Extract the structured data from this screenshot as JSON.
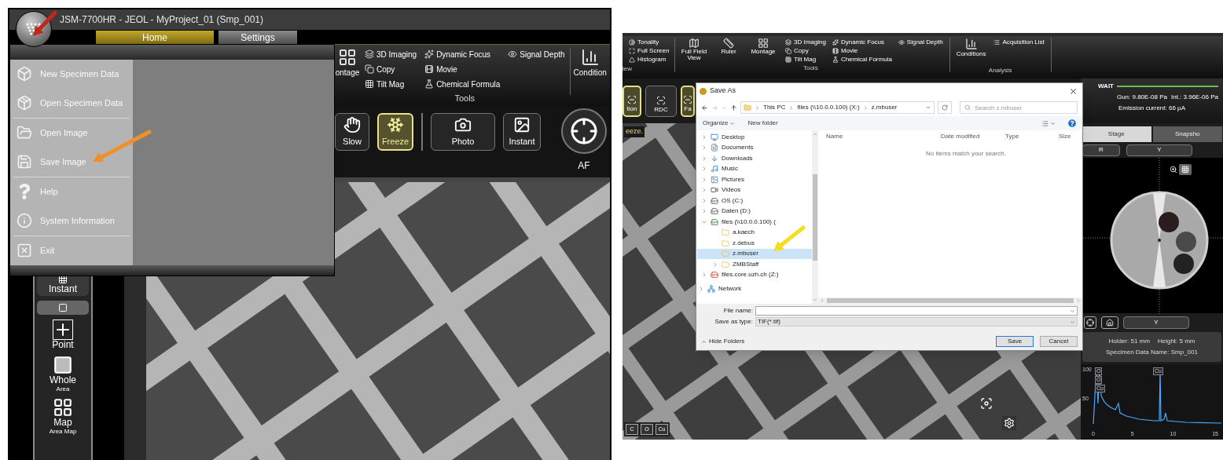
{
  "left_screen": {
    "window_title": "JSM-7700HR - JEOL - MyProject_01 (Smp_001)",
    "tabs": [
      {
        "label": "Home",
        "selected": true
      },
      {
        "label": "Settings",
        "selected": false
      }
    ],
    "ribbon": {
      "montage_label": "ontage",
      "tool_columns": [
        [
          "3D Imaging",
          "Copy",
          "Tilt Mag"
        ],
        [
          "Dynamic Focus",
          "Movie",
          "Chemical Formula"
        ],
        [
          "Signal Depth"
        ]
      ],
      "group_label": "Tools",
      "conditions_label": "Condition"
    },
    "buttons": [
      {
        "label": "Slow",
        "selected": false
      },
      {
        "label": "Freeze",
        "selected": true
      },
      {
        "label": "Photo",
        "selected": false
      },
      {
        "label": "Instant",
        "selected": false
      }
    ],
    "af_label": "AF",
    "sidebar": [
      {
        "label": "Instant"
      },
      {
        "label": "Point"
      },
      {
        "label": "Whole",
        "sublabel": "Area"
      },
      {
        "label": "Map",
        "sublabel": "Area Map"
      }
    ],
    "app_menu": {
      "groups": [
        [
          "New Specimen Data",
          "Open Specimen Data"
        ],
        [
          "Open Image",
          "Save Image"
        ],
        [
          "Help",
          "System Information"
        ],
        [
          "Exit"
        ]
      ]
    }
  },
  "right_screen": {
    "ribbon": {
      "view": {
        "items": [
          "Tonality",
          "Full Screen",
          "Histogram"
        ],
        "label": "iew"
      },
      "tools": {
        "large": [
          "Full Field View",
          "Ruler",
          "Montage"
        ],
        "columns": [
          [
            "3D Imaging",
            "Copy",
            "Tilt Mag"
          ],
          [
            "Dynamic Focus",
            "Movie",
            "Chemical Formula"
          ],
          [
            "Signal Depth"
          ]
        ],
        "label": "Tools"
      },
      "analysis": {
        "large": "Conditions",
        "items": [
          "Acquisition List"
        ],
        "label": "Analysis"
      }
    },
    "mode_buttons": [
      {
        "label": "tion",
        "selected": true
      },
      {
        "label": "RDC",
        "selected": false
      },
      {
        "label": "Fa",
        "selected": true
      }
    ],
    "status": {
      "state": "WAIT",
      "gun": "Gun: 9.80E-08 Pa",
      "int": "Int.: 3.96E-06 Pa",
      "emission": "Emission current: 66 µA"
    },
    "image_label": "eeze.",
    "element_buttons": [
      "C",
      "O",
      "Cu"
    ],
    "side_tabs": [
      {
        "label": "Stage",
        "selected": true
      },
      {
        "label": "Snapsho",
        "selected": false
      }
    ],
    "stage_top_buttons": [
      "R",
      "Y"
    ],
    "stage_bottom_button": "Y",
    "holder": "Holder: 51 mm",
    "height": "Height: 5 mm",
    "specimen": "Specimen Data Name: Smp_001",
    "spectrum": {
      "y_ticks": [
        "100",
        "50"
      ],
      "x_ticks": [
        "0",
        "5",
        "10",
        "15"
      ],
      "peak_labels": [
        "O",
        "O",
        "Cu",
        "Cu"
      ]
    },
    "dialog": {
      "title": "Save As",
      "path": [
        "This PC",
        "files (\\\\10.0.0.100) (X:)",
        "z.mbuser"
      ],
      "search_placeholder": "Search z.mbuser",
      "organize": "Organize",
      "new_folder": "New folder",
      "tree": [
        {
          "label": "Desktop",
          "kind": "desktop",
          "expandable": true,
          "expanded": false,
          "selected": false
        },
        {
          "label": "Documents",
          "kind": "documents",
          "expandable": true,
          "expanded": false,
          "selected": false
        },
        {
          "label": "Downloads",
          "kind": "downloads",
          "expandable": true,
          "expanded": false,
          "selected": false
        },
        {
          "label": "Music",
          "kind": "music",
          "expandable": true,
          "expanded": false,
          "selected": false
        },
        {
          "label": "Pictures",
          "kind": "pictures",
          "expandable": true,
          "expanded": false,
          "selected": false
        },
        {
          "label": "Videos",
          "kind": "videos",
          "expandable": true,
          "expanded": false,
          "selected": false
        },
        {
          "label": "OS (C:)",
          "kind": "drive",
          "expandable": true,
          "expanded": false,
          "selected": false
        },
        {
          "label": "Daten (D:)",
          "kind": "drive",
          "expandable": true,
          "expanded": false,
          "selected": false
        },
        {
          "label": "files (\\\\10.0.0.100) (",
          "kind": "network_drive",
          "expandable": true,
          "expanded": true,
          "selected": false,
          "children": [
            {
              "label": "a.kaech",
              "kind": "folder",
              "expandable": false,
              "expanded": false,
              "selected": false
            },
            {
              "label": "z.debus",
              "kind": "folder",
              "expandable": false,
              "expanded": false,
              "selected": false
            },
            {
              "label": "z.mbuser",
              "kind": "folder",
              "expandable": false,
              "expanded": false,
              "selected": true
            },
            {
              "label": "ZMBStaff",
              "kind": "folder",
              "expandable": true,
              "expanded": false,
              "selected": false
            }
          ]
        },
        {
          "label": "files.core.uzh.ch (Z:)",
          "kind": "disconnected_drive",
          "expandable": true,
          "expanded": false,
          "selected": false
        }
      ],
      "network": {
        "label": "Network",
        "expandable": true,
        "expanded": false,
        "selected": false
      },
      "columns": [
        "Name",
        "Date modified",
        "Type",
        "Size"
      ],
      "empty_message": "No items match your search.",
      "file_name_label": "File name:",
      "save_type_label": "Save as type:",
      "save_type": "TIF(*.tif)",
      "hide_folders": "Hide Folders",
      "save": "Save",
      "cancel": "Cancel"
    }
  }
}
